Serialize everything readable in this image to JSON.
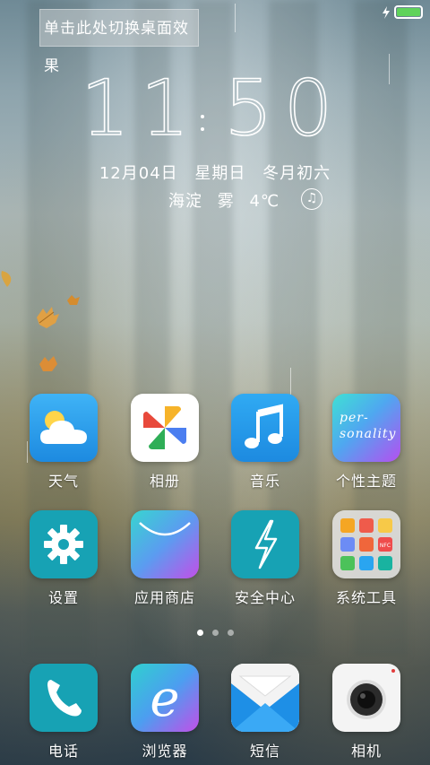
{
  "hint": {
    "text": "单击此处切换桌面效果"
  },
  "status": {
    "battery_level": 1.0
  },
  "clock": {
    "hours": "11",
    "minutes": "50"
  },
  "date": {
    "date": "12月04日",
    "weekday": "星期日",
    "lunar": "冬月初六"
  },
  "weather": {
    "location": "海淀",
    "condition": "雾",
    "temperature": "4℃"
  },
  "music": {
    "icon": "music-note-icon"
  },
  "apps_row1": [
    {
      "label": "天气",
      "icon": "weather-icon"
    },
    {
      "label": "相册",
      "icon": "gallery-pinwheel-icon"
    },
    {
      "label": "音乐",
      "icon": "music-note-icon"
    },
    {
      "label": "个性主题",
      "icon": "themes-icon",
      "icon_text_1": "per-",
      "icon_text_2": "sonality"
    }
  ],
  "apps_row2": [
    {
      "label": "设置",
      "icon": "gear-icon"
    },
    {
      "label": "应用商店",
      "icon": "app-store-icon"
    },
    {
      "label": "安全中心",
      "icon": "security-bolt-icon"
    },
    {
      "label": "系统工具",
      "icon": "folder-icon",
      "folder_items": [
        "calculator",
        "clock",
        "files",
        "recorder",
        "scanner",
        "nfc",
        "chat",
        "compass",
        "radar"
      ],
      "nfc_text": "NFC"
    }
  ],
  "dock": [
    {
      "label": "电话",
      "icon": "phone-icon"
    },
    {
      "label": "浏览器",
      "icon": "browser-icon"
    },
    {
      "label": "短信",
      "icon": "messages-envelope-icon"
    },
    {
      "label": "相机",
      "icon": "camera-icon"
    }
  ],
  "pager": {
    "pages": 3,
    "active": 0
  },
  "colors": {
    "accent_blue": "#2a9df4",
    "teal": "#17a2b4",
    "battery_green": "#5fd35a"
  }
}
